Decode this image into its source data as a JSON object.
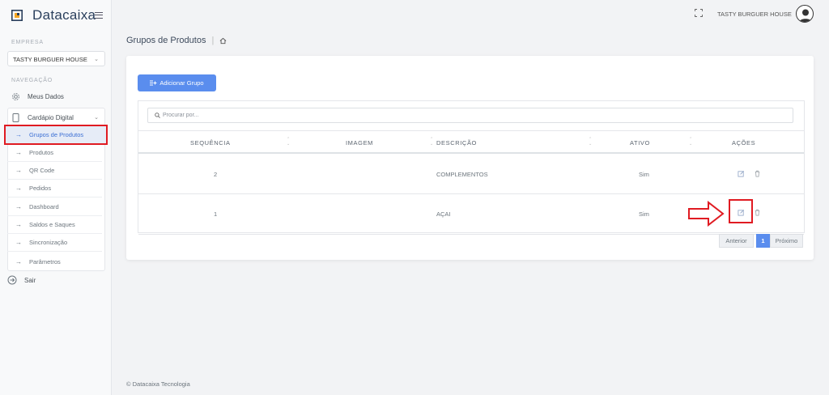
{
  "app": {
    "name": "Datacaixa"
  },
  "sidebar": {
    "company_label": "EMPRESA",
    "company_value": "TASTY BURGUER HOUSE",
    "nav_label": "NAVEGAÇÃO",
    "my_data": "Meus Dados",
    "digital_menu": "Cardápio Digital",
    "sub_items": [
      {
        "label": "Grupos de Produtos",
        "active": true
      },
      {
        "label": "Produtos"
      },
      {
        "label": "QR Code"
      },
      {
        "label": "Pedidos"
      },
      {
        "label": "Dashboard"
      },
      {
        "label": "Saldos e Saques"
      },
      {
        "label": "Sincronização"
      },
      {
        "label": "Parâmetros"
      }
    ],
    "logout": "Sair"
  },
  "header": {
    "user": "TASTY BURGUER HOUSE"
  },
  "breadcrumb": {
    "title": "Grupos de Produtos"
  },
  "toolbar": {
    "add_label": "Adicionar Grupo"
  },
  "search": {
    "placeholder": "Procurar por..."
  },
  "table": {
    "columns": [
      "SEQUÊNCIA",
      "IMAGEM",
      "DESCRIÇÃO",
      "ATIVO",
      "AÇÕES"
    ],
    "rows": [
      {
        "seq": "2",
        "desc": "COMPLEMENTOS",
        "active": "Sim"
      },
      {
        "seq": "1",
        "desc": "AÇAI",
        "active": "Sim"
      }
    ]
  },
  "pagination": {
    "prev": "Anterior",
    "page": "1",
    "next": "Próximo"
  },
  "footer": {
    "text": "© Datacaixa Tecnologia"
  },
  "colors": {
    "primary": "#5a8dee",
    "highlight": "#e01b22"
  }
}
